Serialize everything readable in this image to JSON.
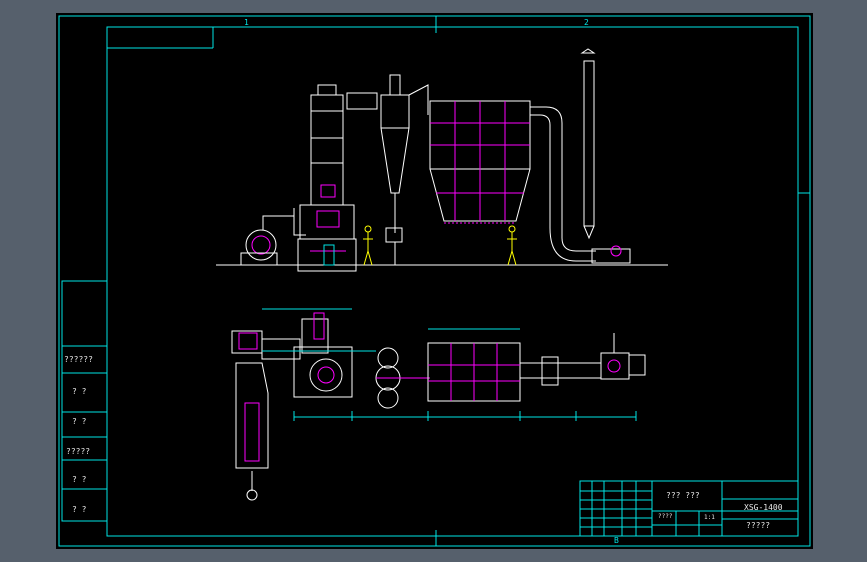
{
  "zone_labels": {
    "col1": "1",
    "col2": "2",
    "bottom": "B"
  },
  "left_table": [
    "??????",
    "? ?",
    "? ?",
    "?????",
    "? ?",
    "? ?"
  ],
  "title_block": {
    "name": "??? ???",
    "code": "XSG-1400",
    "material": "?????",
    "scale_label": "????",
    "sheet_no": "1:1"
  },
  "colors": {
    "frame": "#00e5e5",
    "equipment": "#ffffff",
    "highlight": "#ff00ff",
    "dimension": "#00e5e5",
    "annotation": "#ffff00",
    "background": "#000000",
    "canvas": "#56606c"
  }
}
